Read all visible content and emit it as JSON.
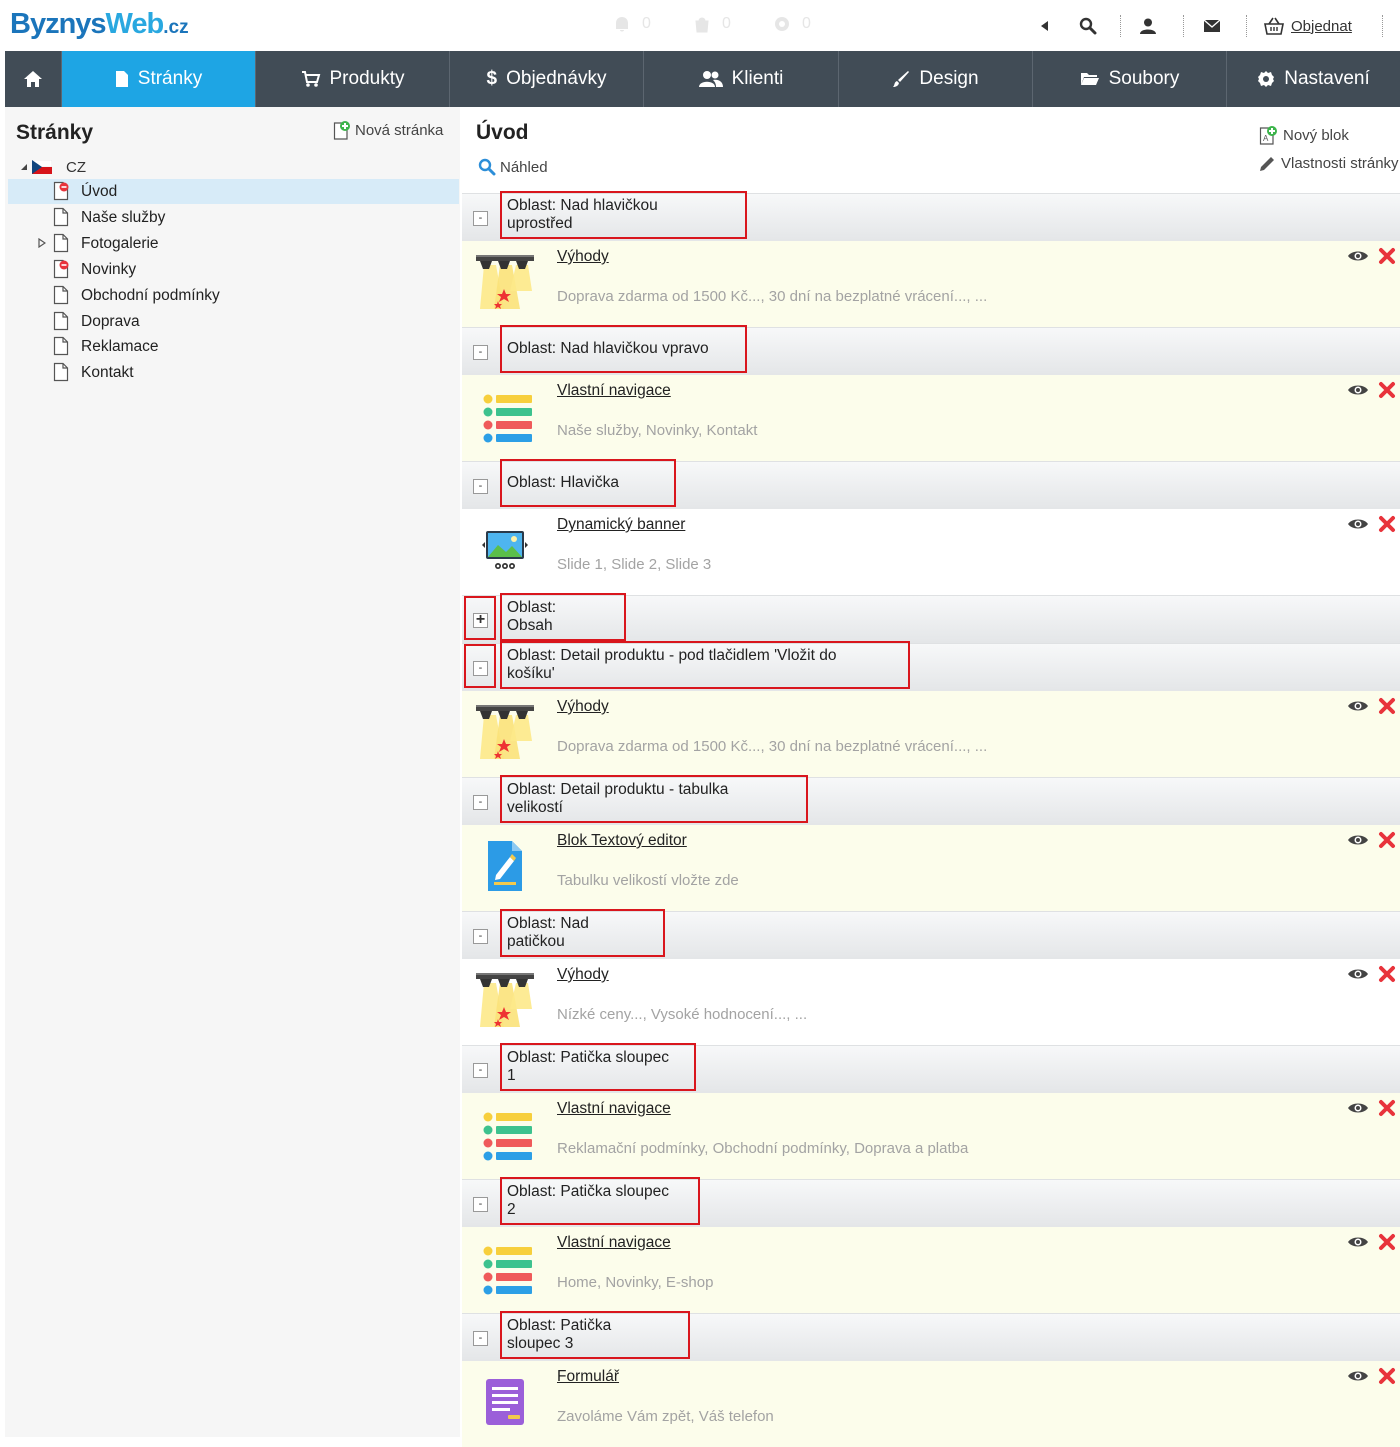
{
  "logo": {
    "part1": "Byznys",
    "part2": "Web",
    "tld": ".cz"
  },
  "topbar": {
    "notif_counts": [
      "0",
      "0",
      "0"
    ],
    "order_label": "Objednat"
  },
  "menu": {
    "items": [
      {
        "label": ""
      },
      {
        "label": "Stránky"
      },
      {
        "label": "Produkty"
      },
      {
        "label": "Objednávky"
      },
      {
        "label": "Klienti"
      },
      {
        "label": "Design"
      },
      {
        "label": "Soubory"
      },
      {
        "label": "Nastavení"
      }
    ]
  },
  "sidebar": {
    "title": "Stránky",
    "new_page": "Nová stránka",
    "root": "CZ",
    "items": [
      {
        "label": "Úvod"
      },
      {
        "label": "Naše služby"
      },
      {
        "label": "Fotogalerie"
      },
      {
        "label": "Novinky"
      },
      {
        "label": "Obchodní podmínky"
      },
      {
        "label": "Doprava"
      },
      {
        "label": "Reklamace"
      },
      {
        "label": "Kontakt"
      }
    ]
  },
  "main": {
    "title": "Úvod",
    "preview": "Náhled",
    "new_block": "Nový blok",
    "page_props": "Vlastnosti stránky",
    "areas": [
      {
        "label": "Oblast: Nad hlavičkou uprostřed",
        "toggle": "-"
      },
      {
        "label": "Oblast: Nad hlavičkou vpravo",
        "toggle": "-"
      },
      {
        "label": "Oblast: Hlavička",
        "toggle": "-"
      },
      {
        "label": "Oblast: Obsah",
        "toggle": "+"
      },
      {
        "label": "Oblast: Detail produktu - pod tlačidlem 'Vložit do košíku'",
        "toggle": "-"
      },
      {
        "label": "Oblast: Detail produktu - tabulka velikostí",
        "toggle": "-"
      },
      {
        "label": "Oblast: Nad patičkou",
        "toggle": "-"
      },
      {
        "label": "Oblast: Patička sloupec 1",
        "toggle": "-"
      },
      {
        "label": "Oblast: Patička sloupec 2",
        "toggle": "-"
      },
      {
        "label": "Oblast: Patička sloupec 3",
        "toggle": "-"
      }
    ],
    "blocks": [
      {
        "title": "Výhody",
        "desc": "Doprava zdarma od 1500 Kč..., 30 dní na bezplatné vrácení..., ...",
        "icon": "stage-icon"
      },
      {
        "title": "Vlastní navigace",
        "desc": "Naše služby, Novinky, Kontakt",
        "icon": "navigation-icon"
      },
      {
        "title": "Dynamický banner",
        "desc": "Slide 1, Slide 2, Slide 3",
        "icon": "banner-icon"
      },
      {
        "title": "Výhody",
        "desc": "Doprava zdarma od 1500 Kč..., 30 dní na bezplatné vrácení..., ...",
        "icon": "stage-icon"
      },
      {
        "title": "Blok Textový editor",
        "desc": "Tabulku velikostí vložte zde",
        "icon": "text-editor-icon"
      },
      {
        "title": "Výhody",
        "desc": "Nízké ceny..., Vysoké hodnocení..., ...",
        "icon": "stage-icon"
      },
      {
        "title": "Vlastní navigace",
        "desc": "Reklamační podmínky, Obchodní podmínky, Doprava a platba",
        "icon": "navigation-icon"
      },
      {
        "title": "Vlastní navigace",
        "desc": "Home, Novinky, E-shop",
        "icon": "navigation-icon"
      },
      {
        "title": "Formulář",
        "desc": "Zavoláme Vám zpět, Váš telefon",
        "icon": "form-icon"
      }
    ]
  },
  "colors": {
    "menu_bg": "#414c56",
    "menu_active": "#1ea5e4",
    "highlight": "#d9161d",
    "block_bg": "#fcfdeb"
  }
}
